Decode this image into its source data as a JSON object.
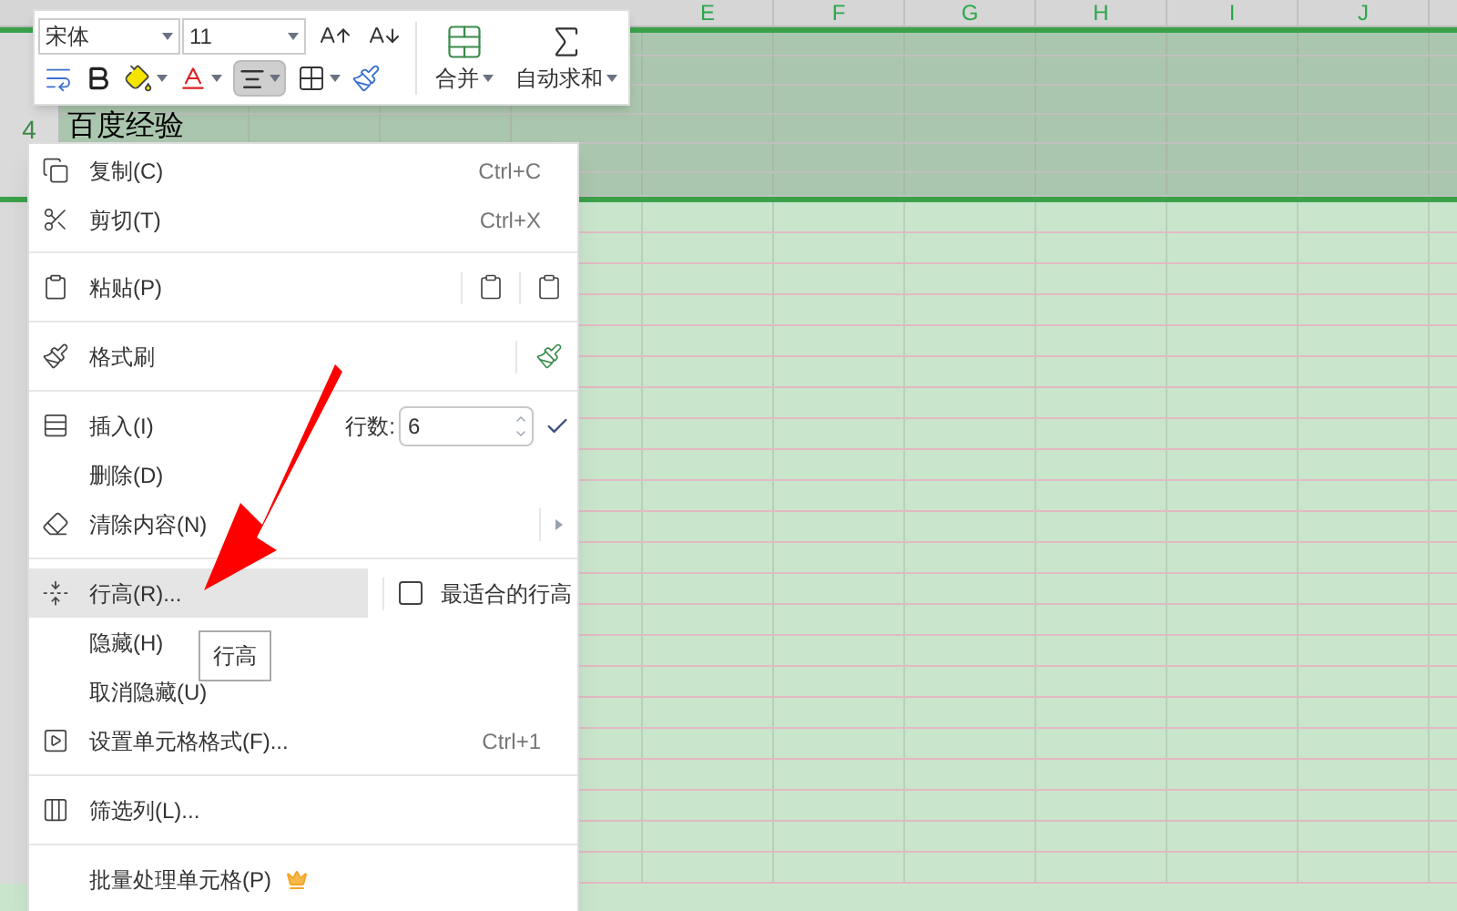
{
  "columns": [
    {
      "label": "E"
    },
    {
      "label": "F"
    },
    {
      "label": "G"
    },
    {
      "label": "H"
    },
    {
      "label": "I"
    },
    {
      "label": "J"
    }
  ],
  "rows": [
    {
      "selected": true
    },
    {
      "selected": true
    },
    {
      "selected": true
    },
    {
      "label": "4",
      "selected": true,
      "cell_a": "百度经验"
    },
    {
      "selected": true
    },
    {
      "selected": true
    },
    {
      "selected": false
    },
    {
      "selected": false
    },
    {
      "selected": false
    },
    {
      "selected": false
    },
    {
      "selected": false
    },
    {
      "selected": false
    },
    {
      "selected": false
    },
    {
      "selected": false
    },
    {
      "selected": false
    },
    {
      "selected": false
    },
    {
      "selected": false
    },
    {
      "selected": false
    },
    {
      "selected": false
    },
    {
      "selected": false
    },
    {
      "selected": false
    },
    {
      "selected": false
    },
    {
      "selected": false
    },
    {
      "selected": false
    },
    {
      "selected": false
    },
    {
      "selected": false
    },
    {
      "selected": false
    },
    {
      "selected": false
    }
  ],
  "toolbar": {
    "font_name": "宋体",
    "font_size": "11",
    "align_selected": true,
    "merge_label": "合并",
    "autosum_label": "自动求和"
  },
  "menu": {
    "groups": [
      {
        "items": [
          {
            "kind": "action",
            "label": "复制(C)",
            "shortcut": "Ctrl+C",
            "selected": false
          },
          {
            "kind": "action",
            "label": "剪切(T)",
            "shortcut": "Ctrl+X",
            "selected": false
          }
        ]
      },
      {
        "items": [
          {
            "kind": "paste",
            "label": "粘贴(P)",
            "selected": false
          }
        ]
      },
      {
        "items": [
          {
            "kind": "brush",
            "label": "格式刷",
            "selected": false
          }
        ]
      },
      {
        "items": [
          {
            "kind": "insert",
            "label": "插入(I)",
            "count_label": "行数:",
            "count_value": "6",
            "selected": false
          },
          {
            "kind": "action",
            "label": "删除(D)",
            "selected": false
          },
          {
            "kind": "submenu",
            "label": "清除内容(N)",
            "selected": false
          }
        ]
      },
      {
        "items": [
          {
            "kind": "split",
            "label": "行高(R)...",
            "side_label": "最适合的行高",
            "selected": true
          },
          {
            "kind": "action",
            "label": "隐藏(H)",
            "selected": false
          },
          {
            "kind": "action",
            "label": "取消隐藏(U)",
            "selected": false
          },
          {
            "kind": "action",
            "label": "设置单元格格式(F)...",
            "shortcut": "Ctrl+1",
            "selected": false
          }
        ]
      },
      {
        "items": [
          {
            "kind": "action",
            "label": "筛选列(L)...",
            "selected": false
          }
        ]
      },
      {
        "items": [
          {
            "kind": "premium",
            "label": "批量处理单元格(P)",
            "selected": false
          }
        ]
      }
    ]
  },
  "tooltip": {
    "text": "行高"
  }
}
